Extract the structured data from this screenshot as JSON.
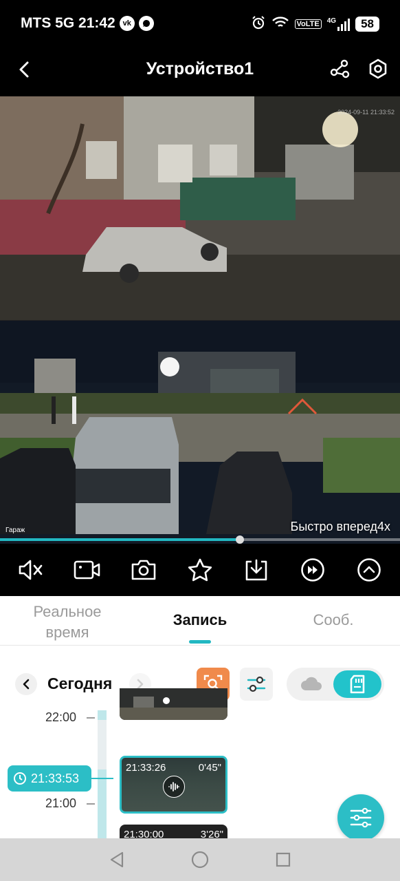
{
  "status_bar": {
    "carrier_time": "MTS 5G 21:42",
    "app_icons": [
      "vk-icon",
      "message-icon"
    ],
    "vk_text": "vk",
    "volte": "VoLTE",
    "network": "4G",
    "battery": "58"
  },
  "header": {
    "title": "Устройство1"
  },
  "video": {
    "playback_speed_label": "Быстро вперед4x",
    "camera_name": "Гараж",
    "osd_timestamp": "2024-09-11 21:33:52",
    "progress": 0.6
  },
  "controls": {
    "icons": [
      "mute-icon",
      "record-video-icon",
      "snapshot-icon",
      "favorite-icon",
      "download-icon",
      "fast-forward-icon",
      "expand-up-icon"
    ]
  },
  "tabs": {
    "realtime": "Реальное время",
    "record": "Запись",
    "events": "Сооб."
  },
  "date_bar": {
    "label": "Сегодня"
  },
  "timeline": {
    "labels": [
      "22:00",
      "21:00"
    ],
    "current_time": "21:33:53",
    "clips": [
      {
        "start": "",
        "duration": ""
      },
      {
        "start": "21:33:26",
        "duration": "0'45\""
      },
      {
        "start": "21:30:00",
        "duration": "3'26\""
      }
    ]
  },
  "colors": {
    "accent": "#2cbec6",
    "search_button": "#f08a4b"
  }
}
